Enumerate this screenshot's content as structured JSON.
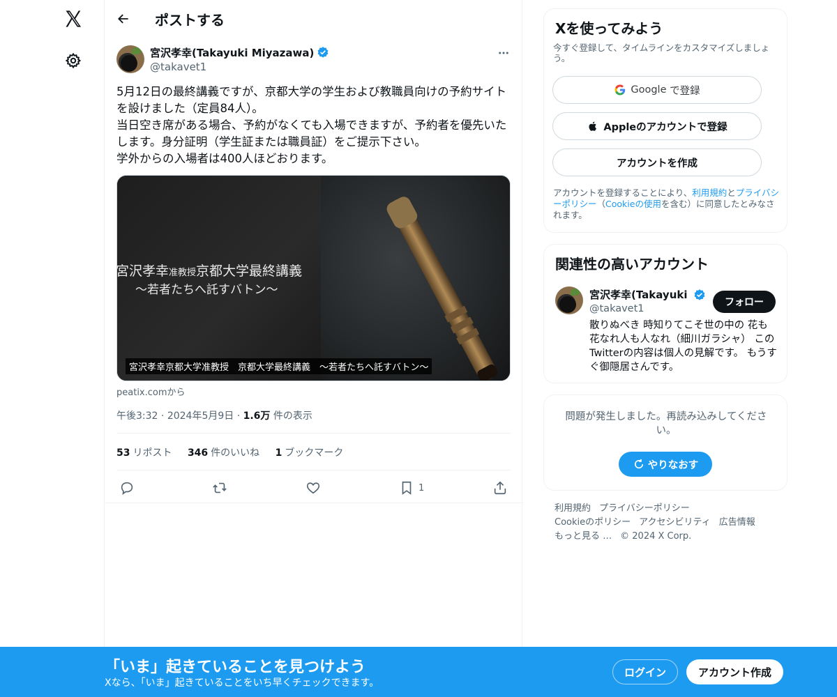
{
  "header": {
    "title": "ポストする"
  },
  "tweet": {
    "author_name": "宮沢孝幸(Takayuki Miyazawa)",
    "author_handle": "@takavet1",
    "text": "5月12日の最終講義ですが、京都大学の学生および教職員向けの予約サイトを設けました（定員84人）。\n当日空き席がある場合、予約がなくても入場できますが、予約者を優先いたします。身分証明（学生証または職員証）をご提示下さい。\n学外からの入場者は400人ほどおります。",
    "media": {
      "title_main_a": "宮沢孝幸",
      "title_small": "准教授",
      "title_main_b": "京都大学最終講義",
      "title_line2": "～若者たちへ託すバトン～",
      "caption": "宮沢孝幸京都大学准教授　京都大学最終講義　～若者たちへ託すバトン～"
    },
    "source": "peatix.comから",
    "time": "午後3:32",
    "date": "2024年5月9日",
    "views_count": "1.6万",
    "views_label": "件の表示",
    "reposts_count": "53",
    "reposts_label": "リポスト",
    "likes_count": "346",
    "likes_label": "件のいいね",
    "bookmarks_count": "1",
    "bookmarks_label": "ブックマーク",
    "bookmark_action_count": "1"
  },
  "signup": {
    "title": "Xを使ってみよう",
    "subtitle": "今すぐ登録して、タイムラインをカスタマイズしましょう。",
    "google_brand": "Google",
    "google_suffix": "で登録",
    "apple_label": "Appleのアカウントで登録",
    "create_label": "アカウントを作成",
    "legal_prefix": "アカウントを登録することにより、",
    "legal_terms": "利用規約",
    "legal_and": "と",
    "legal_privacy": "プライバシーポリシー",
    "legal_open": "（",
    "legal_cookie": "Cookieの使用",
    "legal_suffix": "を含む）に同意したとみなされます。"
  },
  "related": {
    "title": "関連性の高いアカウント",
    "name": "宮沢孝幸(Takayuki Miyazawa)",
    "handle": "@takavet1",
    "follow_label": "フォロー",
    "bio": "散りぬべき 時知りてこそ世の中の 花も花なれ人も人なれ（細川ガラシャ） このTwitterの内容は個人の見解です。 もうすぐ御隠居さんです。"
  },
  "error": {
    "message": "問題が発生しました。再読み込みしてください。",
    "retry_label": "やりなおす"
  },
  "footer": {
    "terms": "利用規約",
    "privacy": "プライバシーポリシー",
    "cookie": "Cookieのポリシー",
    "accessibility": "アクセシビリティ",
    "ads": "広告情報",
    "more": "もっと見る …",
    "copyright": "© 2024 X Corp."
  },
  "banner": {
    "title": "「いま」起きていることを見つけよう",
    "subtitle": "Xなら、「いま」起きていることをいち早くチェックできます。",
    "login_label": "ログイン",
    "signup_label": "アカウント作成"
  },
  "colors": {
    "accent": "#1d9bf0",
    "text": "#0f1419",
    "secondary": "#536471",
    "border": "#eff3f4"
  },
  "icons": [
    "x-logo-icon",
    "gear-icon",
    "back-arrow-icon",
    "verified-icon",
    "more-icon",
    "reply-icon",
    "repost-icon",
    "like-icon",
    "bookmark-icon",
    "share-icon",
    "google-icon",
    "apple-icon",
    "refresh-icon"
  ]
}
